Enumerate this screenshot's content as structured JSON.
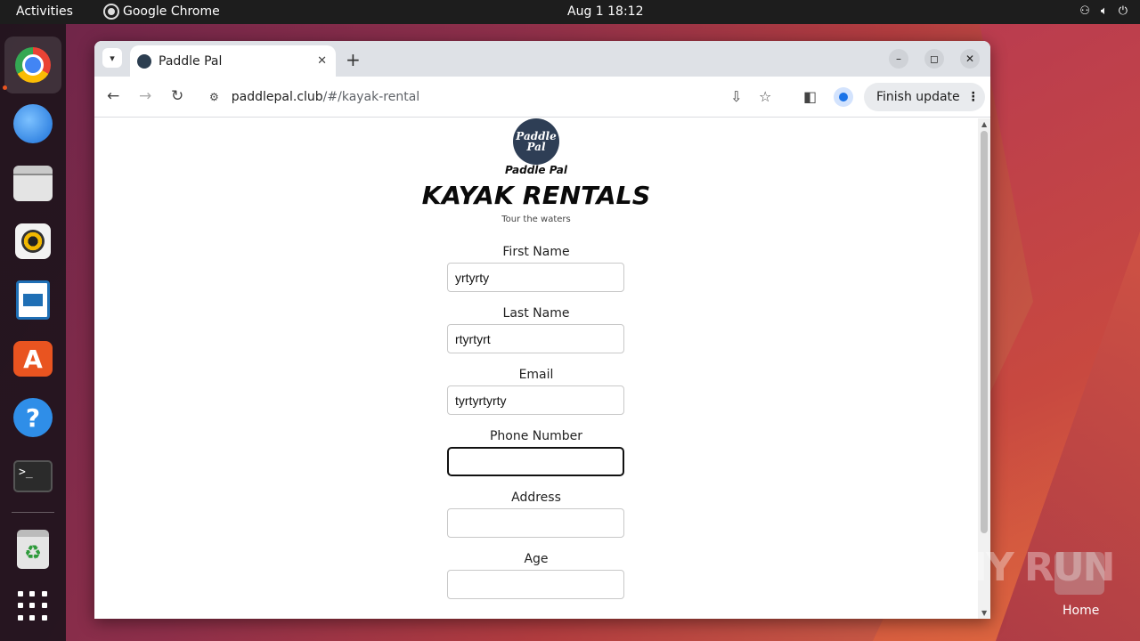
{
  "topbar": {
    "activities": "Activities",
    "app_name": "Google Chrome",
    "clock": "Aug 1  18:12"
  },
  "dock": {
    "items": [
      "chrome-icon",
      "thunderbird-icon",
      "files-icon",
      "rhythmbox-icon",
      "writer-icon",
      "app-center-icon",
      "help-icon",
      "terminal-icon",
      "trash-icon",
      "show-apps-icon"
    ],
    "terminal_glyph": ">_",
    "help_glyph": "?",
    "store_glyph": "A"
  },
  "browser": {
    "tab_title": "Paddle Pal",
    "url_host": "paddlepal.club",
    "url_path": "/#/kayak-rental",
    "finish_update": "Finish update"
  },
  "page": {
    "logo_text": "Paddle Pal",
    "logo_caption": "Paddle Pal",
    "headline": "KAYAK RENTALS",
    "tagline": "Tour the waters",
    "fields": [
      {
        "label": "First Name",
        "value": "yrtyrty"
      },
      {
        "label": "Last Name",
        "value": "rtyrtyrt"
      },
      {
        "label": "Email",
        "value": "tyrtyrtyrty"
      },
      {
        "label": "Phone Number",
        "value": ""
      },
      {
        "label": "Address",
        "value": ""
      },
      {
        "label": "Age",
        "value": ""
      }
    ]
  },
  "desktop": {
    "watermark": "ANY RUN",
    "home_label": "Home"
  },
  "colors": {
    "topbar": "#1d1d1d",
    "accent": "#e95420",
    "chrome_tabstrip": "#dee1e6",
    "logo_bg": "#2e3e55"
  }
}
